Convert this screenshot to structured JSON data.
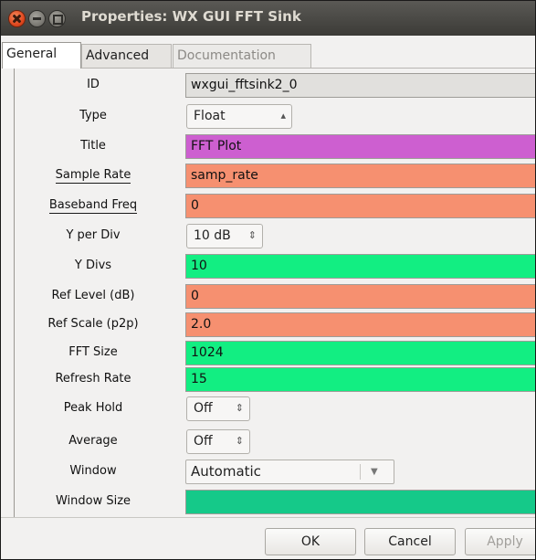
{
  "window": {
    "title": "Properties: WX GUI FFT Sink"
  },
  "tabs": [
    {
      "label": "General"
    },
    {
      "label": "Advanced"
    },
    {
      "label": "Documentation"
    }
  ],
  "params": {
    "id": {
      "label": "ID",
      "value": "wxgui_fftsink2_0",
      "color": "#e1e0dd"
    },
    "type": {
      "label": "Type",
      "value": "Float"
    },
    "title": {
      "label": "Title",
      "value": "FFT Plot",
      "color": "#cd5fd0"
    },
    "sample_rate": {
      "label": "Sample Rate",
      "value": "samp_rate",
      "color": "#f69070"
    },
    "baseband_freq": {
      "label": "Baseband Freq",
      "value": "0",
      "color": "#f69070"
    },
    "y_per_div": {
      "label": "Y per Div",
      "value": "10 dB"
    },
    "y_divs": {
      "label": "Y Divs",
      "value": "10",
      "color": "#12ee82"
    },
    "ref_level": {
      "label": "Ref Level (dB)",
      "value": "0",
      "color": "#f69070"
    },
    "ref_scale": {
      "label": "Ref Scale (p2p)",
      "value": "2.0",
      "color": "#f69070"
    },
    "fft_size": {
      "label": "FFT Size",
      "value": "1024",
      "color": "#12ee82"
    },
    "refresh_rate": {
      "label": "Refresh Rate",
      "value": "15",
      "color": "#12ee82"
    },
    "peak_hold": {
      "label": "Peak Hold",
      "value": "Off"
    },
    "average": {
      "label": "Average",
      "value": "Off"
    },
    "window": {
      "label": "Window",
      "value": "Automatic"
    },
    "window_size": {
      "label": "Window Size",
      "value": "",
      "color": "#15c989"
    }
  },
  "buttons": {
    "ok": "OK",
    "cancel": "Cancel",
    "apply": "Apply"
  }
}
